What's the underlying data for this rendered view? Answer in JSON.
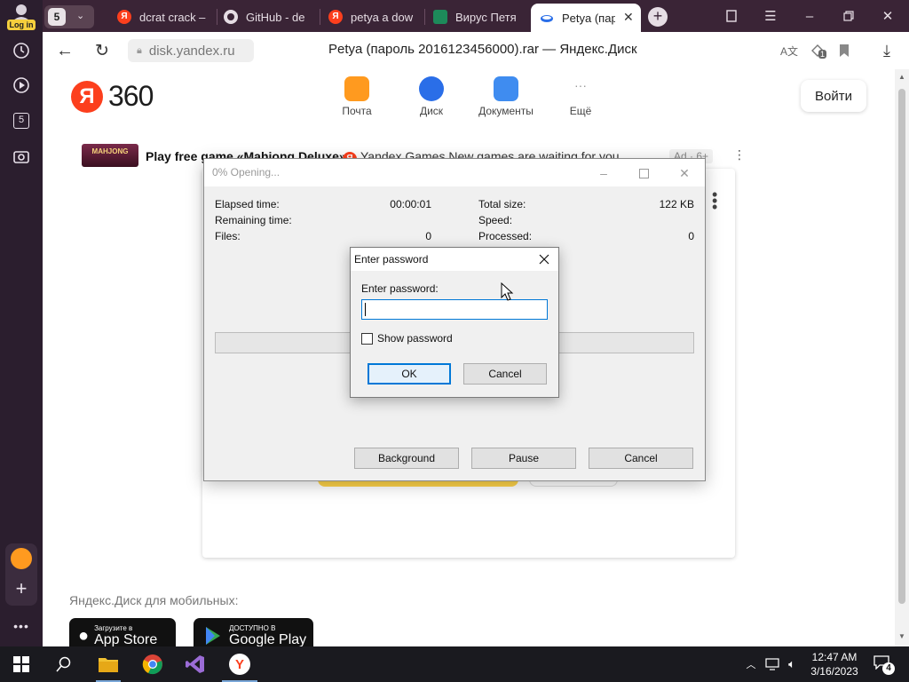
{
  "browser": {
    "login_label": "Log in",
    "tab_count": "5",
    "tabs": [
      {
        "title": "dcrat crack –",
        "icon": "yandex-icon"
      },
      {
        "title": "GitHub - de",
        "icon": "github-icon"
      },
      {
        "title": "petya a dow",
        "icon": "yandex-icon"
      },
      {
        "title": "Вирус Петя",
        "icon": "site-icon"
      },
      {
        "title": "Petya (пар",
        "icon": "yandex-disk-icon",
        "active": true
      }
    ],
    "sidebar_count": "5",
    "url": "disk.yandex.ru",
    "page_title": "Petya (пароль 2016123456000).rar — Яндекс.Диск",
    "extension_badge": "1"
  },
  "page": {
    "logo_text": "360",
    "logo_letter": "Я",
    "services": [
      {
        "label": "Почта",
        "color": "#ff9a1f"
      },
      {
        "label": "Диск",
        "color": "#2a6ee8"
      },
      {
        "label": "Документы",
        "color": "#3f8cf0"
      },
      {
        "label": "Ещё",
        "color": ""
      }
    ],
    "login_button": "Войти",
    "ad": {
      "thumb_text": "MAHJONG",
      "title": "Play free game «Mahjong Deluxe»",
      "source": "Yandex Games   New games are waiting for you",
      "label": "Ad · 6+"
    },
    "mobile_label": "Яндекс.Диск для мобильных:",
    "app_store": {
      "small": "Загрузите в",
      "big": "App Store"
    },
    "google_play": {
      "small": "ДОСТУПНО В",
      "big": "Google Play"
    }
  },
  "progress_dialog": {
    "title": "0% Opening...",
    "elapsed_label": "Elapsed time:",
    "elapsed_value": "00:00:01",
    "remaining_label": "Remaining time:",
    "files_label": "Files:",
    "files_value": "0",
    "total_label": "Total size:",
    "total_value": "122 KB",
    "speed_label": "Speed:",
    "processed_label": "Processed:",
    "processed_value": "0",
    "background_button": "Background",
    "pause_button": "Pause",
    "cancel_button": "Cancel"
  },
  "password_dialog": {
    "title": "Enter password",
    "field_label": "Enter password:",
    "field_value": "",
    "show_password_label": "Show password",
    "show_password_checked": false,
    "ok_button": "OK",
    "cancel_button": "Cancel"
  },
  "taskbar": {
    "time": "12:47 AM",
    "date": "3/16/2023",
    "notification_count": "4"
  }
}
